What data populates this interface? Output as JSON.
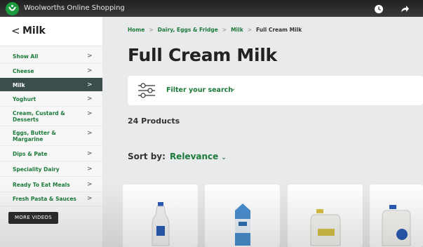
{
  "video": {
    "title": "Woolworths Online Shopping",
    "more_videos": "MORE VIDEOS"
  },
  "sidebar": {
    "back_glyph": "<",
    "title": "Milk",
    "items": [
      {
        "label": "Show All"
      },
      {
        "label": "Cheese"
      },
      {
        "label": "Milk",
        "active": true
      },
      {
        "label": "Yoghurt"
      },
      {
        "label": "Cream, Custard &\nDesserts"
      },
      {
        "label": "Eggs, Butter &\nMargarine"
      },
      {
        "label": "Dips & Pate"
      },
      {
        "label": "Speciality Dairy"
      },
      {
        "label": "Ready To Eat Meals"
      },
      {
        "label": "Fresh Pasta & Sauces"
      }
    ]
  },
  "breadcrumb": {
    "home": "Home",
    "level1": "Dairy, Eggs & Fridge",
    "level2": "Milk",
    "current": "Full Cream Milk",
    "separator": ">"
  },
  "main": {
    "title": "Full Cream Milk",
    "filter_label": "Filter your search",
    "product_count": "24 Products",
    "sort_label": "Sort by:",
    "sort_value": "Relevance"
  },
  "colors": {
    "brand_green": "#1c7a3a",
    "active_bg": "#3a4f4d"
  }
}
